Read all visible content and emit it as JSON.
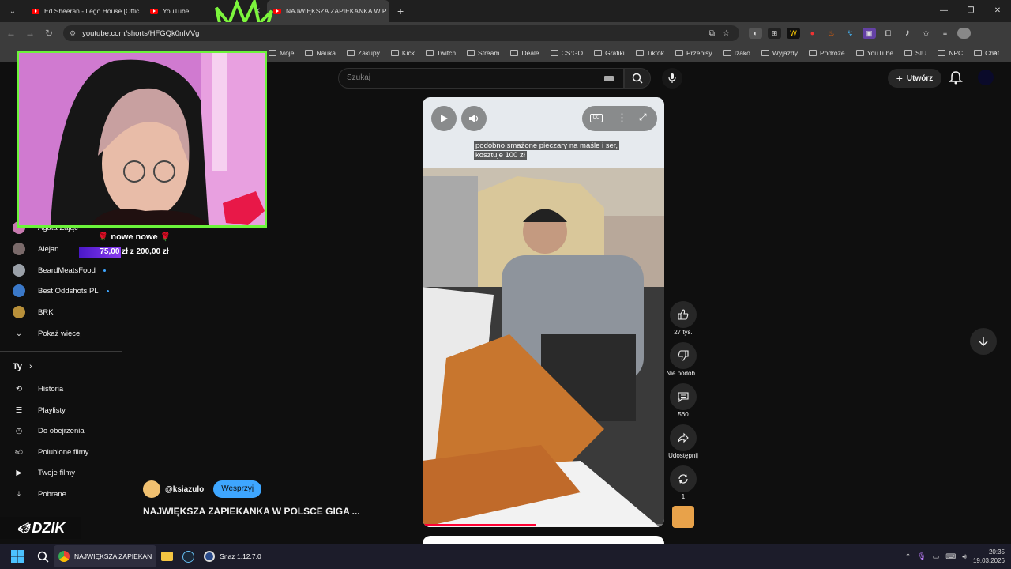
{
  "browser": {
    "tabs": [
      {
        "title": "Ed Sheeran - Lego House [Offic",
        "active": false
      },
      {
        "title": "YouTube",
        "active": false
      },
      {
        "title": "NAJWIĘKSZA ZAPIEKANKA W P",
        "active": true
      }
    ],
    "url": "youtube.com/shorts/HFGQk0nlVVg",
    "bookmarks": [
      "Moje",
      "Nauka",
      "Zakupy",
      "Kick",
      "Twitch",
      "Stream",
      "Deale",
      "CS:GO",
      "Grafiki",
      "Tiktok",
      "Przepisy",
      "Izako",
      "Wyjazdy",
      "Podróże",
      "YouTube",
      "SIU",
      "NPC",
      "Chat"
    ]
  },
  "youtube": {
    "search_placeholder": "Szukaj",
    "create_label": "Utwórz",
    "sidebar": {
      "channels": [
        {
          "name": "Agata Zając",
          "color": "#c87ab0"
        },
        {
          "name": "Alejan...",
          "color": "#7a6a6a"
        },
        {
          "name": "BeardMeatsFood",
          "color": "#9aa0a8"
        },
        {
          "name": "Best Oddshots PL",
          "color": "#3a78c8"
        },
        {
          "name": "BRK",
          "color": "#b8903a"
        }
      ],
      "show_more": "Pokaż więcej",
      "you_heading": "Ty",
      "you_items": [
        {
          "label": "Historia",
          "icon": "history-icon"
        },
        {
          "label": "Playlisty",
          "icon": "playlist-icon"
        },
        {
          "label": "Do obejrzenia",
          "icon": "clock-icon"
        },
        {
          "label": "Polubione filmy",
          "icon": "thumbs-up-icon"
        },
        {
          "label": "Twoje filmy",
          "icon": "video-icon"
        },
        {
          "label": "Pobrane",
          "icon": "download-icon"
        }
      ]
    },
    "video": {
      "caption_line1": "podobno smażone pieczary na maśle i ser,",
      "caption_line2": "kosztuje 100 zł",
      "progress": 0.47
    },
    "actions": {
      "likes": "27 tys.",
      "dislike": "Nie podob...",
      "comments": "560",
      "share": "Udostępnij",
      "remix": "1"
    },
    "owner": {
      "handle": "@ksiazulo",
      "support": "Wesprzyj"
    },
    "title": "NAJWIĘKSZA ZAPIEKANKA W POLSCE GIGA ..."
  },
  "stream_overlay": {
    "donation_title": "🌹 nowe nowe 🌹",
    "goal_text": "75,00 zł  z  200,00 zł",
    "goal_fraction": 0.375,
    "brand": "DZIK"
  },
  "taskbar": {
    "apps": [
      {
        "label": "NAJWIĘKSZA ZAPIEKAN",
        "active": true
      },
      {
        "label": "",
        "active": false
      },
      {
        "label": "",
        "active": false
      },
      {
        "label": "Snaz 1.12.7.0",
        "active": false
      }
    ],
    "time": "20:35",
    "date": "19.03.2026"
  }
}
